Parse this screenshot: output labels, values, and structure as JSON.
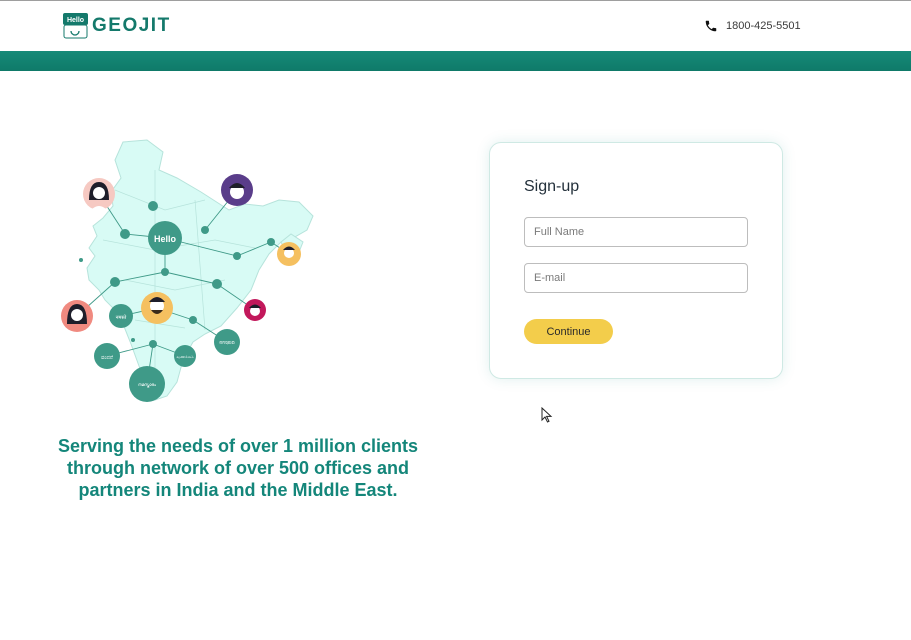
{
  "header": {
    "logo_badge_text": "Hello",
    "logo_text": "GEOJIT",
    "phone_number": "1800-425-5501"
  },
  "illustration": {
    "hello_label": "Hello",
    "language_bubbles": [
      "नमस्ते",
      "ವಂದನೆ",
      "നമസ്കാരം",
      "வணக்கம்",
      "ନମସ୍କାର"
    ]
  },
  "tagline": "Serving the needs of over 1 million clients through network of over 500 offices and partners in India and the Middle East.",
  "signup": {
    "title": "Sign-up",
    "full_name_placeholder": "Full Name",
    "full_name_value": "",
    "email_placeholder": "E-mail",
    "email_value": "",
    "continue_label": "Continue"
  },
  "colors": {
    "brand_teal": "#14796b",
    "button_yellow": "#f3cd4b",
    "map_fill": "#d8fbf5"
  }
}
